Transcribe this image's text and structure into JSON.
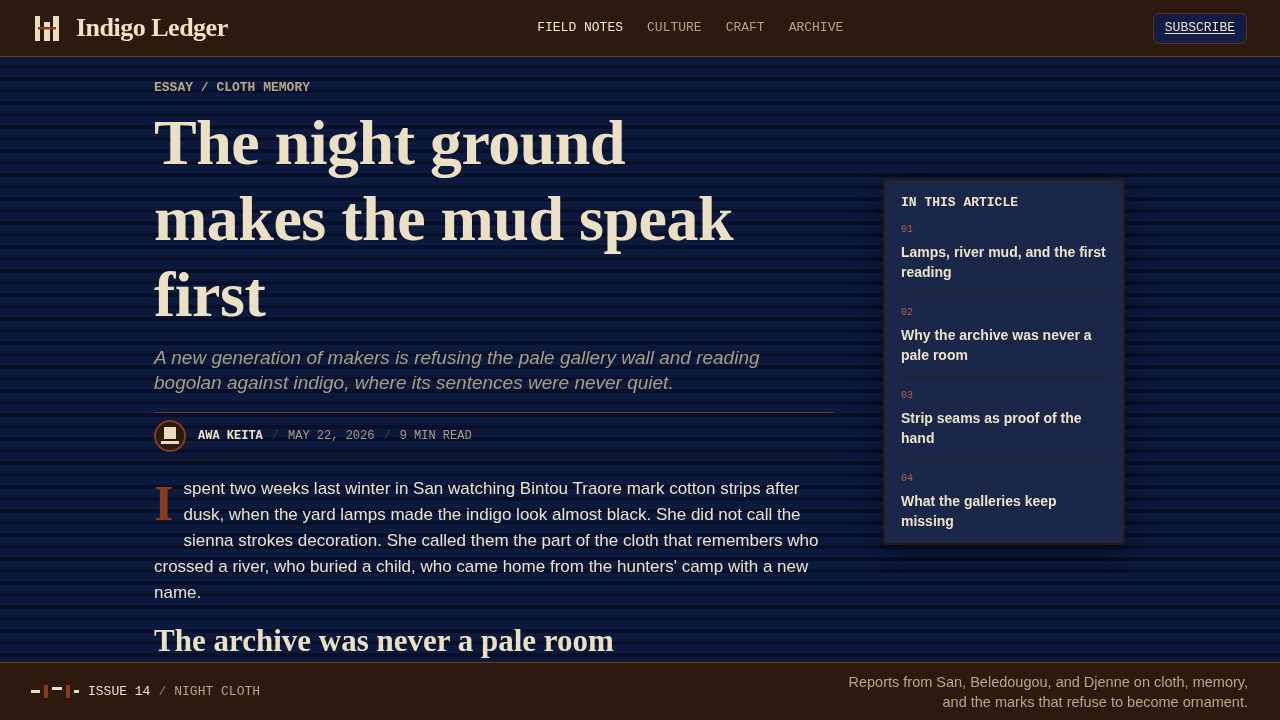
{
  "header": {
    "logo": "Indigo Ledger",
    "nav": [
      {
        "label": "FIELD NOTES",
        "selected": true
      },
      {
        "label": "CULTURE",
        "selected": false
      },
      {
        "label": "CRAFT",
        "selected": false
      },
      {
        "label": "ARCHIVE",
        "selected": false
      }
    ],
    "subscribe": "SUBSCRIBE"
  },
  "article": {
    "kicker": "ESSAY / CLOTH MEMORY",
    "title": "The night ground makes the mud speak first",
    "dek": "A new generation of makers is refusing the pale gallery wall and reading bogolan against indigo, where its sentences were never quiet.",
    "byline": [
      {
        "kind": "author",
        "text": "AWA KEITA"
      },
      {
        "kind": "separator",
        "text": "/"
      },
      {
        "kind": "meta",
        "text": "MAY 22, 2026"
      },
      {
        "kind": "separator",
        "text": "/"
      },
      {
        "kind": "meta",
        "text": "9 MIN READ"
      }
    ],
    "lede": "I spent two weeks last winter in San watching Bintou Traore mark cotton strips after dusk, when the yard lamps made the indigo look almost black. She did not call the sienna strokes decoration. She called them the part of the cloth that remembers who crossed a river, who buried a child, who came home from the hunters' camp with a new name.",
    "section_heading": "The archive was never a pale room"
  },
  "toc": {
    "heading": "IN THIS ARTICLE",
    "items": [
      {
        "number": "01",
        "title": "Lamps, river mud, and the first reading"
      },
      {
        "number": "02",
        "title": "Why the archive was never a pale room"
      },
      {
        "number": "03",
        "title": "Strip seams as proof of the hand"
      },
      {
        "number": "04",
        "title": "What the galleries keep missing"
      }
    ]
  },
  "footer": {
    "issue": "ISSUE 14",
    "separator": "/",
    "theme": "NIGHT CLOTH",
    "tagline": "Reports from San, Beledougou, and Djenne on cloth, memory,\nand the marks that refuse to become ornament."
  }
}
